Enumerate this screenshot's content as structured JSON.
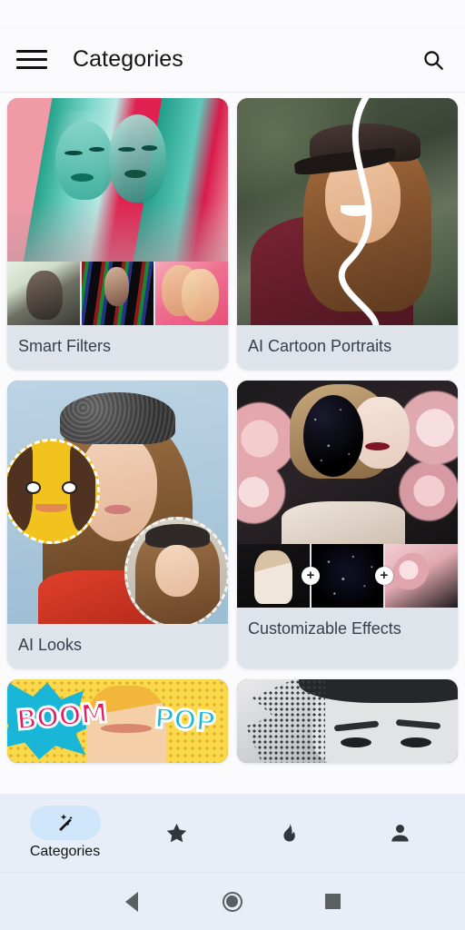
{
  "appbar": {
    "title": "Categories",
    "menu_icon": "hamburger-menu-icon",
    "search_icon": "search-icon"
  },
  "categories": [
    {
      "label": "Smart Filters",
      "layout": "hero-plus-thumbnails",
      "hero_description": "Pink and teal duotone multi-exposure portrait",
      "thumbnails": [
        "Light duotone portrait",
        "Dark portrait with rainbow light streaks",
        "Pink multi-exposure portrait"
      ]
    },
    {
      "label": "AI Cartoon Portraits",
      "layout": "hero-only",
      "hero_description": "Smiling woman in leather cap split by white curve between photo and cartoon"
    },
    {
      "label": "AI Looks",
      "layout": "hero-with-avatars",
      "hero_description": "Woman in grey knit beanie on blue background",
      "avatars": [
        "Yellow cartoon avatar face",
        "Illustrated painted portrait avatar"
      ]
    },
    {
      "label": "Customizable Effects",
      "layout": "hero-plus-thumbnails-with-plus",
      "hero_description": "Woman with roses and galaxy circle overlay on face",
      "thumbnails": [
        "Woman portrait on dark background",
        "Starry galaxy texture",
        "Pink roses"
      ],
      "connector": "+"
    },
    {
      "label": "",
      "layout": "hero-only-partial",
      "hero_description": "Pop art comic effect with BOOM and POP text",
      "comic_text_left": "BOOM",
      "comic_text_right": "POP"
    },
    {
      "label": "",
      "layout": "hero-only-partial",
      "hero_description": "Black and white portrait with dispersion particle effect"
    }
  ],
  "bottom_nav": [
    {
      "label": "Categories",
      "icon": "magic-wand-icon",
      "active": true
    },
    {
      "label": "",
      "icon": "star-icon",
      "active": false
    },
    {
      "label": "",
      "icon": "flame-icon",
      "active": false
    },
    {
      "label": "",
      "icon": "person-icon",
      "active": false
    }
  ],
  "system_nav": [
    {
      "icon": "back-triangle-icon"
    },
    {
      "icon": "home-circle-icon"
    },
    {
      "icon": "recents-square-icon"
    }
  ],
  "colors": {
    "page_background": "#fbfbfe",
    "appbar_background": "#fafafc",
    "card_label_background": "#dfe3ea",
    "card_label_text": "#36404d",
    "bottom_nav_background": "#e8eef8",
    "active_pill": "#cfe6fb"
  }
}
